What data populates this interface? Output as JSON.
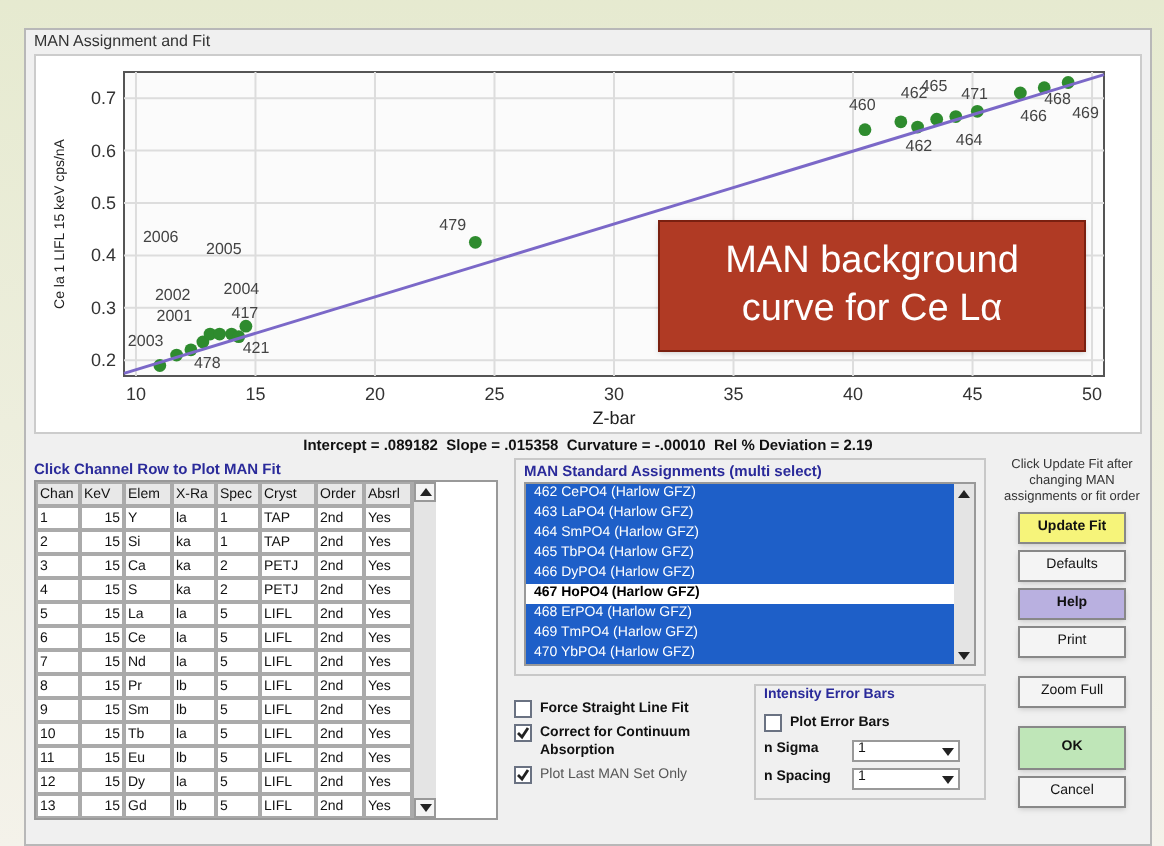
{
  "window": {
    "title": "MAN Assignment and Fit"
  },
  "chart": {
    "chart_data": {
      "type": "scatter",
      "grid": true,
      "xlabel": "Z-bar",
      "ylabel": "Ce la 1 LIFL 15 keV cps/nA",
      "xlim": [
        9.5,
        50.5
      ],
      "ylim": [
        0.17,
        0.75
      ],
      "xticks": [
        10,
        15,
        20,
        25,
        30,
        35,
        40,
        45,
        50
      ],
      "yticks": [
        0.2,
        0.3,
        0.4,
        0.5,
        0.6,
        0.7
      ],
      "series": [
        {
          "type": "scatter",
          "color": "#2e8b2e",
          "x": [
            11,
            11.7,
            12.3,
            12.8,
            13.1,
            13.5,
            14,
            14.3,
            14.6,
            24.2,
            40.5,
            42,
            42.7,
            43.5,
            44.3,
            45.2,
            47,
            48,
            49
          ],
          "values": [
            0.19,
            0.21,
            0.22,
            0.235,
            0.25,
            0.25,
            0.25,
            0.245,
            0.265,
            0.425,
            0.64,
            0.655,
            0.645,
            0.66,
            0.665,
            0.675,
            0.71,
            0.72,
            0.73
          ]
        },
        {
          "type": "line",
          "color": "#7b68c8",
          "x": [
            9.5,
            50.5
          ],
          "values": [
            0.175,
            0.745
          ]
        }
      ],
      "annotations": [
        "2003",
        "2001",
        "2002",
        "2006",
        "2005",
        "2004",
        "417",
        "421",
        "478",
        "479",
        "460",
        "462",
        "462",
        "465",
        "464",
        "471",
        "466",
        "468",
        "469"
      ]
    }
  },
  "overlay_note": {
    "text": "MAN background curve for Ce Lα"
  },
  "fit_summary": "Intercept = .089182  Slope = .015358  Curvature = -.00010  Rel % Deviation = 2.19",
  "channel_table": {
    "label": "Click Channel Row to Plot MAN Fit",
    "columns": [
      "Chan",
      "KeV",
      "Elem",
      "X-Ra",
      "Spec",
      "Cryst",
      "Order",
      "Absrl"
    ],
    "rows": [
      [
        "1",
        "15",
        "Y",
        "la",
        "1",
        "TAP",
        "2nd",
        "Yes"
      ],
      [
        "2",
        "15",
        "Si",
        "ka",
        "1",
        "TAP",
        "2nd",
        "Yes"
      ],
      [
        "3",
        "15",
        "Ca",
        "ka",
        "2",
        "PETJ",
        "2nd",
        "Yes"
      ],
      [
        "4",
        "15",
        "S",
        "ka",
        "2",
        "PETJ",
        "2nd",
        "Yes"
      ],
      [
        "5",
        "15",
        "La",
        "la",
        "5",
        "LIFL",
        "2nd",
        "Yes"
      ],
      [
        "6",
        "15",
        "Ce",
        "la",
        "5",
        "LIFL",
        "2nd",
        "Yes"
      ],
      [
        "7",
        "15",
        "Nd",
        "la",
        "5",
        "LIFL",
        "2nd",
        "Yes"
      ],
      [
        "8",
        "15",
        "Pr",
        "lb",
        "5",
        "LIFL",
        "2nd",
        "Yes"
      ],
      [
        "9",
        "15",
        "Sm",
        "lb",
        "5",
        "LIFL",
        "2nd",
        "Yes"
      ],
      [
        "10",
        "15",
        "Tb",
        "la",
        "5",
        "LIFL",
        "2nd",
        "Yes"
      ],
      [
        "11",
        "15",
        "Eu",
        "lb",
        "5",
        "LIFL",
        "2nd",
        "Yes"
      ],
      [
        "12",
        "15",
        "Dy",
        "la",
        "5",
        "LIFL",
        "2nd",
        "Yes"
      ],
      [
        "13",
        "15",
        "Gd",
        "lb",
        "5",
        "LIFL",
        "2nd",
        "Yes"
      ]
    ]
  },
  "assignments": {
    "label": "MAN Standard Assignments (multi select)",
    "items": [
      {
        "text": "462 CePO4 (Harlow GFZ)",
        "selected": true
      },
      {
        "text": "463 LaPO4 (Harlow GFZ)",
        "selected": true
      },
      {
        "text": "464 SmPO4 (Harlow GFZ)",
        "selected": true
      },
      {
        "text": "465 TbPO4 (Harlow GFZ)",
        "selected": true
      },
      {
        "text": "466 DyPO4 (Harlow GFZ)",
        "selected": true
      },
      {
        "text": "467 HoPO4 (Harlow GFZ)",
        "selected": false
      },
      {
        "text": "468 ErPO4 (Harlow GFZ)",
        "selected": true
      },
      {
        "text": "469 TmPO4 (Harlow GFZ)",
        "selected": true
      },
      {
        "text": "470 YbPO4 (Harlow GFZ)",
        "selected": true
      }
    ]
  },
  "options": [
    {
      "label": "Force Straight Line Fit",
      "checked": false
    },
    {
      "label": "Correct for Continuum Absorption",
      "checked": true
    },
    {
      "label": "Plot Last MAN Set Only",
      "checked": true
    }
  ],
  "error_bars": {
    "label": "Intensity Error Bars",
    "plot": {
      "label": "Plot Error Bars",
      "checked": false
    },
    "fields": [
      {
        "label": "n Sigma",
        "value": "1"
      },
      {
        "label": "n Spacing",
        "value": "1"
      }
    ]
  },
  "side": {
    "note": "Click Update Fit after changing MAN assignments or fit order",
    "buttons": [
      {
        "label": "Update Fit",
        "kind": "update"
      },
      {
        "label": "Defaults",
        "kind": "plain"
      },
      {
        "label": "Help",
        "kind": "help"
      },
      {
        "label": "Print",
        "kind": "plain"
      },
      {
        "label": "Zoom Full",
        "kind": "plain"
      },
      {
        "label": "OK",
        "kind": "ok"
      },
      {
        "label": "Cancel",
        "kind": "plain"
      }
    ]
  }
}
